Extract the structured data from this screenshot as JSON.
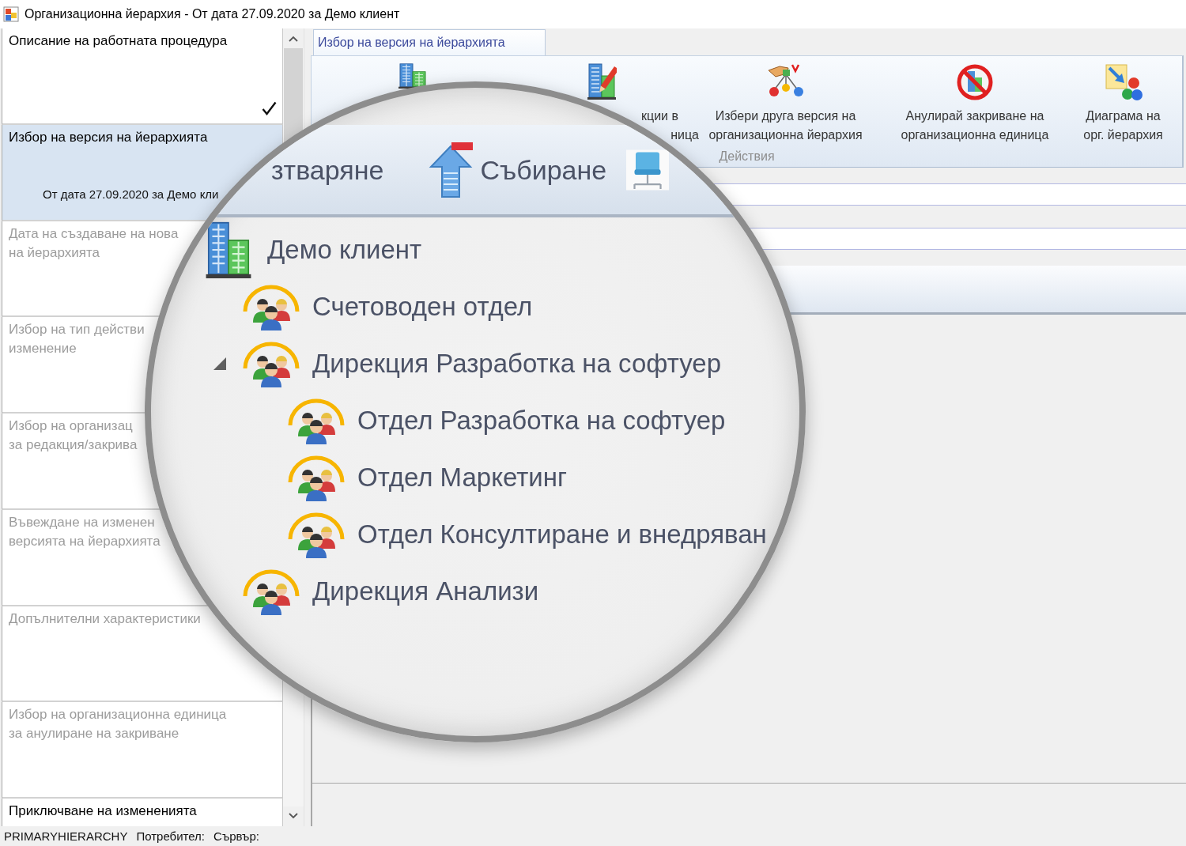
{
  "window": {
    "title": "Организационна йерархия - От дата 27.09.2020 за Демо клиент"
  },
  "steps": [
    {
      "lines": [
        "Описание на работната процедура"
      ],
      "selected": false,
      "done": true,
      "disabled": false
    },
    {
      "lines": [
        "Избор на версия на йерархията"
      ],
      "subtitle": "От дата 27.09.2020 за Демо кли",
      "selected": true,
      "done": false,
      "disabled": false
    },
    {
      "lines": [
        "Дата на създаване на нова",
        "на йерархията"
      ],
      "selected": false,
      "done": false,
      "disabled": true
    },
    {
      "lines": [
        "Избор на тип действи",
        "изменение"
      ],
      "selected": false,
      "done": false,
      "disabled": true
    },
    {
      "lines": [
        "Избор на организац",
        "за редакция/закрива"
      ],
      "selected": false,
      "done": false,
      "disabled": true
    },
    {
      "lines": [
        "Въвеждане на изменен",
        "версията на йерархията"
      ],
      "selected": false,
      "done": false,
      "disabled": true
    },
    {
      "lines": [
        "Допълнителни характеристики"
      ],
      "selected": false,
      "done": false,
      "disabled": true
    },
    {
      "lines": [
        "Избор на организационна единица",
        "за анулиране на закриване"
      ],
      "selected": false,
      "done": false,
      "disabled": true
    },
    {
      "lines": [
        "Приключване на измененията"
      ],
      "selected": false,
      "done": false,
      "disabled": false
    }
  ],
  "tabs": [
    {
      "label": "Избор на версия на йерархията",
      "selected": true
    }
  ],
  "ribbon": {
    "buttons": [
      {
        "kind": "icon"
      },
      {
        "kind": "labeled",
        "label": [
          "кции в",
          "ница"
        ]
      },
      {
        "kind": "labeled",
        "label": [
          "Избери друга версия на",
          "организационна йерархия"
        ]
      },
      {
        "kind": "labeled",
        "label": [
          "Анулирай закриване на",
          "организационна единица"
        ]
      },
      {
        "kind": "labeled",
        "label": [
          "Диаграма на",
          "орг. йерархия"
        ]
      }
    ],
    "group_label": "Действия"
  },
  "magnifier": {
    "toolbar": [
      {
        "kind": "text",
        "label": "зтваряне"
      },
      {
        "kind": "icon-text",
        "label": "Събиране"
      },
      {
        "kind": "icon"
      }
    ],
    "tree": [
      {
        "label": "Демо клиент",
        "children": [
          {
            "label": "Счетоводен отдел"
          },
          {
            "label": "Дирекция Разработка на софтуер",
            "expanded": true,
            "children": [
              {
                "label": "Отдел Разработка на софтуер"
              },
              {
                "label": "Отдел Маркетинг"
              },
              {
                "label": "Отдел Консултиране и внедряван"
              }
            ]
          },
          {
            "label": "Дирекция Анализи"
          }
        ]
      }
    ]
  },
  "status_bar": {
    "items": [
      "PRIMARYHIERARCHY",
      "Потребител:",
      "Сървър:"
    ]
  }
}
